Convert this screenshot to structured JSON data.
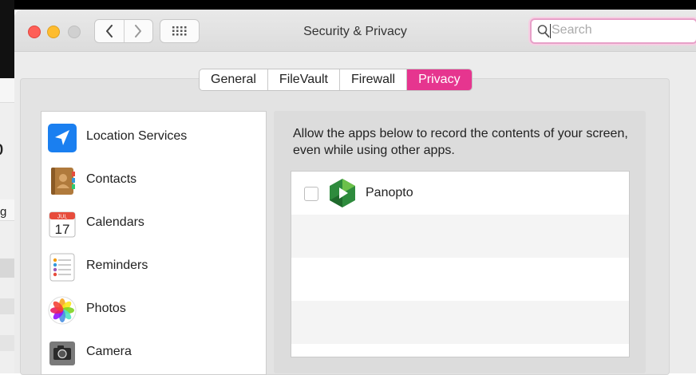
{
  "window": {
    "title": "Security & Privacy"
  },
  "search": {
    "placeholder": "Search"
  },
  "tabs": [
    {
      "label": "General"
    },
    {
      "label": "FileVault"
    },
    {
      "label": "Firewall"
    },
    {
      "label": "Privacy",
      "active": true
    }
  ],
  "sidebar": {
    "items": [
      {
        "label": "Location Services",
        "icon": "location-arrow-icon"
      },
      {
        "label": "Contacts",
        "icon": "contacts-book-icon"
      },
      {
        "label": "Calendars",
        "icon": "calendar-icon",
        "calendar_month": "JUL",
        "calendar_day": "17"
      },
      {
        "label": "Reminders",
        "icon": "reminders-list-icon"
      },
      {
        "label": "Photos",
        "icon": "photos-flower-icon"
      },
      {
        "label": "Camera",
        "icon": "camera-icon"
      }
    ]
  },
  "main": {
    "description": "Allow the apps below to record the contents of your screen, even while using other apps.",
    "apps": [
      {
        "name": "Panopto",
        "checked": false,
        "icon": "panopto-icon"
      }
    ]
  },
  "colors": {
    "accent": "#e6358f",
    "search_focus": "#e7a0c8"
  }
}
